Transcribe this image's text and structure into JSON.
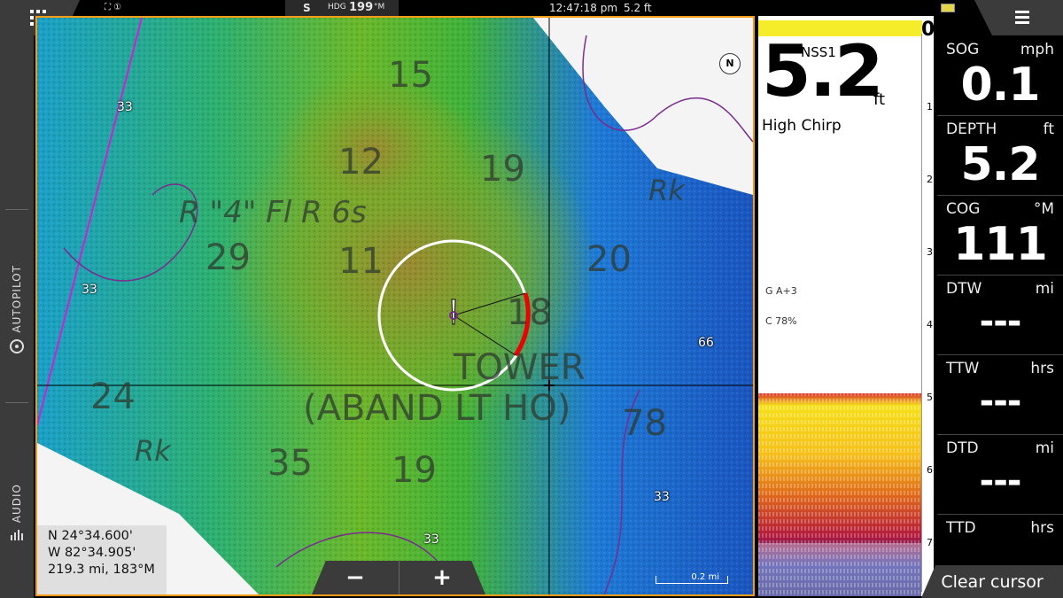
{
  "topbar": {
    "status_icons": "⛶ ①",
    "heading_label": "HDG",
    "heading_value": "199",
    "heading_unit": "°M",
    "heading_mode": "S",
    "time": "12:47:18 pm",
    "depth_readout": "5.2 ft"
  },
  "sidebar": {
    "autopilot_label": "AUTOPILOT",
    "audio_label": "AUDIO"
  },
  "chart": {
    "depth_labels": [
      "15",
      "12",
      "19",
      "11",
      "29",
      "20",
      "18",
      "24",
      "35",
      "19",
      "78"
    ],
    "text_labels": [
      "R \"4\" Fl R 6s",
      "TOWER",
      "(ABAND LT HO)",
      "Rk",
      "Rk"
    ],
    "small_soundings": [
      "33",
      "33",
      "66",
      "33",
      "33"
    ],
    "position": {
      "lat": "N  24°34.600'",
      "lon": "W  82°34.905'",
      "range_bearing": "219.3 mi, 183°M"
    },
    "zoom_out": "−",
    "zoom_in": "+",
    "scale": "0.2 mi",
    "north": "N"
  },
  "sonar": {
    "source": "NSS1",
    "top_depth_marker": "0",
    "depth": "5.2",
    "depth_unit": "ft",
    "frequency": "High Chirp",
    "scale_ticks": [
      "1",
      "2",
      "3",
      "4",
      "5",
      "6",
      "7"
    ],
    "gain": "G A+3",
    "contrast": "C 78%"
  },
  "databar": {
    "items": [
      {
        "label": "SOG",
        "unit": "mph",
        "value": "0.1"
      },
      {
        "label": "DEPTH",
        "unit": "ft",
        "value": "5.2"
      },
      {
        "label": "COG",
        "unit": "°M",
        "value": "111"
      },
      {
        "label": "DTW",
        "unit": "mi",
        "value": "---"
      },
      {
        "label": "TTW",
        "unit": "hrs",
        "value": "---"
      },
      {
        "label": "DTD",
        "unit": "mi",
        "value": "---"
      },
      {
        "label": "TTD",
        "unit": "hrs",
        "value": ""
      }
    ]
  },
  "clear_cursor_label": "Clear cursor",
  "colors": {
    "accent": "#f39c1a",
    "sonar_yellow": "#f5ec2a",
    "panel_gray": "#3b3b3b"
  }
}
